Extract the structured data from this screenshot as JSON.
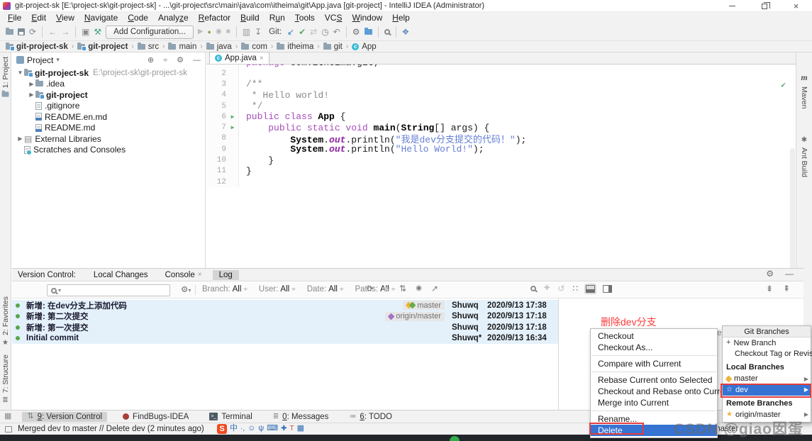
{
  "window": {
    "title": "git-project-sk [E:\\project-sk\\git-project-sk] - ...\\git-project\\src\\main\\java\\com\\itheima\\git\\App.java [git-project] - IntelliJ IDEA (Administrator)"
  },
  "menu_bar": {
    "items": [
      {
        "label": "File",
        "u": 0
      },
      {
        "label": "Edit",
        "u": 0
      },
      {
        "label": "View",
        "u": 0
      },
      {
        "label": "Navigate",
        "u": 0
      },
      {
        "label": "Code",
        "u": 0
      },
      {
        "label": "Analyze",
        "u": 5
      },
      {
        "label": "Refactor",
        "u": 0
      },
      {
        "label": "Build",
        "u": 0
      },
      {
        "label": "Run",
        "u": 1
      },
      {
        "label": "Tools",
        "u": 0
      },
      {
        "label": "VCS",
        "u": 2
      },
      {
        "label": "Window",
        "u": 0
      },
      {
        "label": "Help",
        "u": 0
      }
    ]
  },
  "toolbar": {
    "add_configuration": "Add Configuration...",
    "git_label": "Git:",
    "groups_before_button": [
      [
        "open-icon",
        "save-icon",
        "sync-icon"
      ],
      [
        "back-icon",
        "forward-icon"
      ],
      [
        "run-anything-icon",
        "build-hammer-icon"
      ]
    ],
    "groups_after_button": [
      [
        "run-icon",
        "debug-icon",
        "coverage-icon",
        "stop-icon"
      ],
      [
        "profiler-icon",
        "attach-icon"
      ]
    ],
    "git_group": [
      "update-project-icon",
      "commit-icon",
      "compare-icon",
      "history-icon",
      "rollback-icon"
    ],
    "groups_right": [
      [
        "settings-wrench-icon",
        "project-structure-icon"
      ],
      [
        "search-everywhere-icon"
      ],
      [
        "sdk-icon"
      ]
    ]
  },
  "breadcrumbs": {
    "items": [
      {
        "label": "git-project-sk",
        "icon": "project-folder-icon",
        "bold": true
      },
      {
        "label": "git-project",
        "icon": "project-folder-icon",
        "bold": true
      },
      {
        "label": "src",
        "icon": "folder-icon"
      },
      {
        "label": "main",
        "icon": "folder-icon"
      },
      {
        "label": "java",
        "icon": "folder-icon"
      },
      {
        "label": "com",
        "icon": "folder-icon"
      },
      {
        "label": "itheima",
        "icon": "folder-icon"
      },
      {
        "label": "git",
        "icon": "folder-icon"
      },
      {
        "label": "App",
        "icon": "class-icon"
      }
    ]
  },
  "stripes": {
    "project": "1: Project",
    "favorites": "2: Favorites",
    "structure": "7: Structure",
    "maven": "Maven",
    "ant": "Ant Build"
  },
  "project_panel": {
    "header": "Project",
    "tree": [
      {
        "label": "git-project-sk",
        "path": "E:\\project-sk\\git-project-sk",
        "icon": "project-folder-icon",
        "chevron": "expanded",
        "bold": true,
        "level": 0
      },
      {
        "label": ".idea",
        "icon": "folder-icon",
        "chevron": "collapsed",
        "level": 1
      },
      {
        "label": "git-project",
        "icon": "project-folder-icon",
        "chevron": "collapsed",
        "bold": true,
        "level": 1
      },
      {
        "label": ".gitignore",
        "icon": "gitignore-file-icon",
        "level": 1,
        "file": true
      },
      {
        "label": "README.en.md",
        "icon": "markdown-file-icon",
        "level": 1,
        "file": true
      },
      {
        "label": "README.md",
        "icon": "markdown-file-icon",
        "level": 1,
        "file": true
      },
      {
        "label": "External Libraries",
        "icon": "library-icon",
        "chevron": "collapsed",
        "level": 0
      },
      {
        "label": "Scratches and Consoles",
        "icon": "scratches-icon",
        "level": 0,
        "file": true
      }
    ]
  },
  "editor": {
    "tab": "App.java",
    "clipped_first_line": "package com.itheima.git;",
    "lines": [
      {
        "num": 2,
        "seg": []
      },
      {
        "num": 3,
        "seg": [
          {
            "t": "/**",
            "c": "cmt"
          }
        ]
      },
      {
        "num": 4,
        "seg": [
          {
            "t": " * Hello world!",
            "c": "cmt"
          }
        ]
      },
      {
        "num": 5,
        "seg": [
          {
            "t": " */",
            "c": "cmt"
          }
        ]
      },
      {
        "num": 6,
        "run": true,
        "seg": [
          {
            "t": "public class ",
            "c": "kw"
          },
          {
            "t": "App ",
            "c": "cls"
          },
          {
            "t": "{",
            "c": "pl"
          }
        ]
      },
      {
        "num": 7,
        "run": true,
        "seg": [
          {
            "t": "    ",
            "c": "pl"
          },
          {
            "t": "public static void ",
            "c": "kw"
          },
          {
            "t": "main",
            "c": "meth"
          },
          {
            "t": "(",
            "c": "pl"
          },
          {
            "t": "String",
            "c": "cls"
          },
          {
            "t": "[] args) {",
            "c": "pl"
          }
        ]
      },
      {
        "num": 8,
        "seg": [
          {
            "t": "        ",
            "c": "pl"
          },
          {
            "t": "System",
            "c": "cls"
          },
          {
            "t": ".",
            "c": "pl"
          },
          {
            "t": "out",
            "c": "fld"
          },
          {
            "t": ".println(",
            "c": "pl"
          },
          {
            "t": "\"我是dev分支提交的代码！\"",
            "c": "str"
          },
          {
            "t": ");",
            "c": "pl"
          }
        ]
      },
      {
        "num": 9,
        "seg": [
          {
            "t": "        ",
            "c": "pl"
          },
          {
            "t": "System",
            "c": "cls"
          },
          {
            "t": ".",
            "c": "pl"
          },
          {
            "t": "out",
            "c": "fld"
          },
          {
            "t": ".println(",
            "c": "pl"
          },
          {
            "t": "\"Hello World!\"",
            "c": "str"
          },
          {
            "t": ");",
            "c": "pl"
          }
        ]
      },
      {
        "num": 10,
        "seg": [
          {
            "t": "    }",
            "c": "pl"
          }
        ]
      },
      {
        "num": 11,
        "seg": [
          {
            "t": "}",
            "c": "pl"
          }
        ]
      },
      {
        "num": 12,
        "seg": []
      }
    ]
  },
  "version_control": {
    "label": "Version Control:",
    "tabs": [
      {
        "label": "Local Changes"
      },
      {
        "label": "Console",
        "close": true
      },
      {
        "label": "Log",
        "active": true
      }
    ],
    "filter": {
      "filters": [
        "Branch: All",
        "User: All",
        "Date: All",
        "Paths: All"
      ],
      "left_icons": [
        "refresh-icon",
        "cherry-pick-icon",
        "sort-icon",
        "preview-details-icon",
        "open-in-new-icon"
      ],
      "right_icons": [
        "search-icon",
        "go-forward-icon",
        "undo-icon",
        "presentation-settings-icon",
        "layout-bottom-icon",
        "layout-right-icon"
      ],
      "corner_icons": [
        "expand-all-icon",
        "collapse-all-icon"
      ],
      "header_icons": [
        "gear-icon",
        "hide-icon"
      ]
    },
    "commits": [
      {
        "message": "新增: 在dev分支上添加代码",
        "refs": [
          {
            "label": "master",
            "icons": [
              "tag-yellow-icon",
              "tag-green-icon"
            ]
          }
        ],
        "author": "Shuwq",
        "date": "2020/9/13 17:38"
      },
      {
        "message": "新增: 第二次提交",
        "refs": [
          {
            "label": "origin/master",
            "icons": [
              "tag-purple-icon"
            ]
          }
        ],
        "author": "Shuwq",
        "date": "2020/9/13 17:18"
      },
      {
        "message": "新增: 第一次提交",
        "refs": [],
        "author": "Shuwq",
        "date": "2020/9/13 17:18"
      },
      {
        "message": "Initial commit",
        "refs": [],
        "author": "Shuwq*",
        "date": "2020/9/13 16:34"
      }
    ],
    "details": {
      "annotation": "删除dev分支",
      "placeholder": "Select commit to view details"
    }
  },
  "context_menu": {
    "items": [
      {
        "label": "Checkout"
      },
      {
        "label": "Checkout As..."
      },
      {
        "sep": true
      },
      {
        "label": "Compare with Current"
      },
      {
        "sep": true
      },
      {
        "label": "Rebase Current onto Selected"
      },
      {
        "label": "Checkout and Rebase onto Current"
      },
      {
        "label": "Merge into Current"
      },
      {
        "sep": true
      },
      {
        "label": "Rename..."
      },
      {
        "label": "Delete",
        "selected": true
      }
    ]
  },
  "branches_popup": {
    "title": "Git Branches",
    "items": [
      {
        "label": "New Branch",
        "icon": "plus-icon"
      },
      {
        "label": "Checkout Tag or Revision...",
        "indent": true
      },
      {
        "header": "Local Branches"
      },
      {
        "label": "master",
        "icon": "tag-yellow-icon",
        "submenu": true
      },
      {
        "label": "dev",
        "icon": "star-outline-icon",
        "submenu": true,
        "selected": true
      },
      {
        "header": "Remote Branches"
      },
      {
        "label": "origin/master",
        "icon": "star-yellow-icon",
        "submenu": true
      }
    ]
  },
  "tool_window_bar": {
    "items": [
      {
        "label": "9: Version Control",
        "u": 0,
        "icon": "vcs-icon",
        "active": true
      },
      {
        "label": "FindBugs-IDEA",
        "icon": "findbugs-icon"
      },
      {
        "label": "Terminal",
        "icon": "terminal-icon"
      },
      {
        "label": "0: Messages",
        "u": 0,
        "icon": "messages-icon"
      },
      {
        "label": "6: TODO",
        "u": 0,
        "icon": "todo-icon"
      }
    ]
  },
  "status_bar": {
    "message": "Merged dev to master // Delete dev (2 minutes ago)",
    "git": "Git: master"
  },
  "ime_bar": {
    "icons": [
      "sogou-icon",
      "chinese-mode-icon",
      "punctuation-icon",
      "emoji-icon",
      "mic-icon",
      "keyboard-icon",
      "toolbox-icon",
      "skin-icon",
      "grid-icon"
    ]
  },
  "watermark": "CSDN @giao囡蛋",
  "colors": {
    "accent_blue": "#3673d3",
    "annotation_red": "#e23d3d",
    "run_green": "#59a869",
    "log_row_blue": "#e4f1fb"
  }
}
